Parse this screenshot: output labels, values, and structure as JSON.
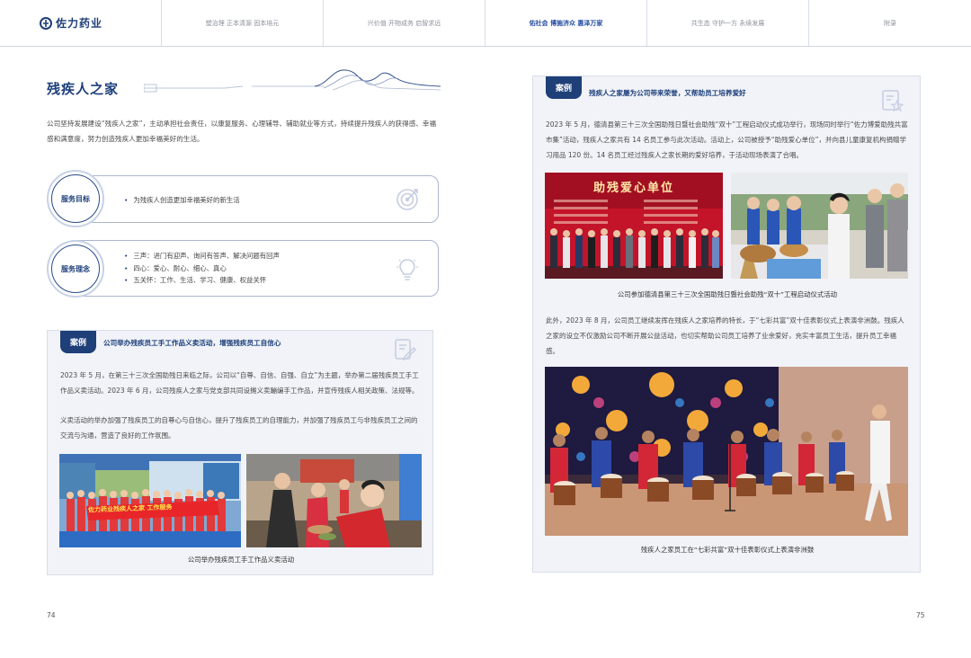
{
  "nav": {
    "brand": "佐力药业",
    "items": [
      {
        "label": "塑治理 正本清源 固本培元",
        "active": false
      },
      {
        "label": "兴价值 开物成务 启智求远",
        "active": false
      },
      {
        "label": "佑社会 博施济众 惠泽万家",
        "active": true
      },
      {
        "label": "共生态 守护一方 永续发展",
        "active": false
      },
      {
        "label": "附录",
        "active": false
      }
    ]
  },
  "left": {
    "title": "残疾人之家",
    "intro": "公司坚持发展建设“残疾人之家”，主动承担社会责任，以康复服务、心理辅导、辅助就业等方式，持续提升残疾人的获得感、幸福感和满意度，努力创造残疾人更加幸福美好的生活。",
    "goal": {
      "label": "服务目标",
      "items": [
        "为残疾人创造更加幸福美好的新生活"
      ]
    },
    "concept": {
      "label": "服务理念",
      "items": [
        "三声：进门有迎声、询问有答声、解决问题有回声",
        "四心：爱心、耐心、细心、真心",
        "五关怀：工作、生活、学习、健康、权益关怀"
      ]
    },
    "case": {
      "tag": "案例",
      "heading": "公司举办残疾员工手工作品义卖活动，增强残疾员工自信心",
      "para1": "2023 年 5 月，在第三十三次全国助残日来临之际，公司以“自尊、自信、自强、自立”为主题，举办第二届残疾员工手工作品义卖活动。2023 年 6 月，公司残疾人之家与党支部共同设摊义卖蹦编手工作品，并宣传残疾人相关政策、法规等。",
      "para2": "义卖活动的举办加强了残疾员工的自尊心与自信心，提升了残疾员工的自理能力，并加强了残疾员工与非残疾员工之间的交流与沟通，营造了良好的工作氛围。",
      "banner_text": "佐力药业残疾人之家 工作服务",
      "caption": "公司举办残疾员工手工作品义卖活动"
    },
    "page_number": "74"
  },
  "right": {
    "case": {
      "tag": "案例",
      "heading": "残疾人之家屡为公司带来荣誉，又帮助员工培养爱好",
      "para1": "2023 年 5 月，德清县第三十三次全国助残日暨社会助残“双十”工程启动仪式成功举行，现场同时举行“佐力博爱助残共富市集”活动，残疾人之家共有 14 名员工参与此次活动。活动上，公司被授予“助残爱心单位”，并向县儿童康复机构捐赠学习用品 120 份。14 名员工经过残疾人之家长期的爱好培养，于活动现场表演了合唱。",
      "stage_text": "助残爱心单位",
      "caption1": "公司参加德清县第三十三次全国助残日暨社会助残“双十”工程启动仪式活动",
      "para2": "此外，2023 年 8 月，公司员工继续发挥在残疾人之家培养的特长，于“七彩共富”双十佳表彰仪式上表演非洲鼓。残疾人之家的设立不仅激励公司不断开展公益活动，也切实帮助公司员工培养了业余爱好，充实丰富员工生活，提升员工幸福感。",
      "caption2": "残疾人之家员工在“七彩共富”双十佳表彰仪式上表演非洲鼓"
    },
    "page_number": "75"
  },
  "colors": {
    "primary": "#1d3f7b",
    "case_bg": "#f1f3f8",
    "border": "#aab6cf"
  }
}
